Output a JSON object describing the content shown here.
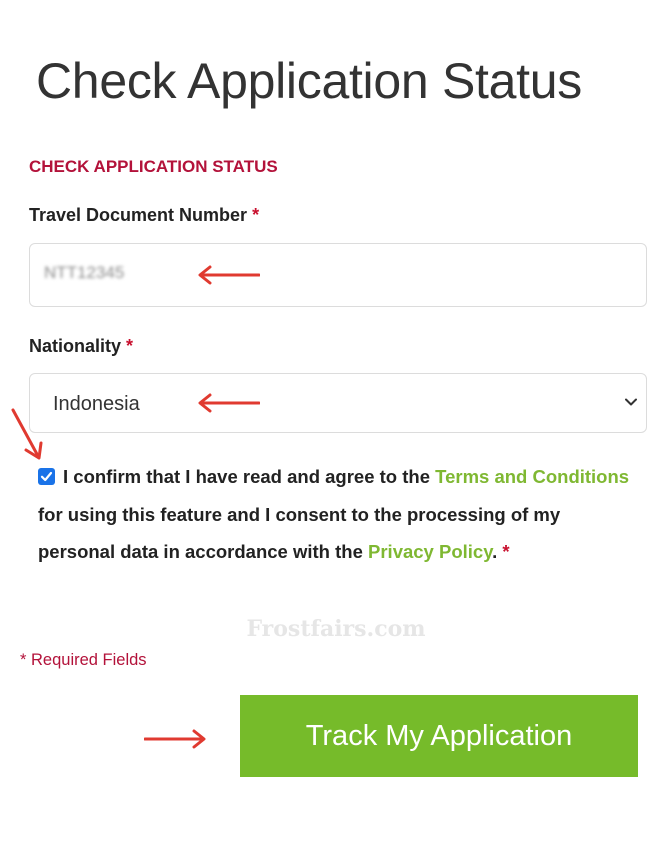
{
  "page": {
    "title": "Check Application Status"
  },
  "form": {
    "section_heading": "CHECK APPLICATION STATUS",
    "travel_document": {
      "label": "Travel Document Number",
      "required_mark": "*",
      "value": "NTT12345"
    },
    "nationality": {
      "label": "Nationality",
      "required_mark": "*",
      "selected": "Indonesia"
    },
    "consent": {
      "checked": true,
      "text_1": "I confirm that I have read and agree to the ",
      "terms_link": "Terms and Conditions",
      "text_2": " for using this feature and I consent to the processing of my personal data in accordance with the ",
      "privacy_link": "Privacy Policy",
      "text_3": ".",
      "required_mark": "*"
    },
    "required_note": "* Required Fields",
    "submit_label": "Track My Application"
  },
  "watermark": "Frostfairs.com",
  "colors": {
    "accent_red": "#b3123a",
    "link_green": "#7fb832",
    "button_green": "#76bb2a",
    "annotation_arrow": "#e03a30",
    "checkbox_blue": "#1a73e8"
  }
}
